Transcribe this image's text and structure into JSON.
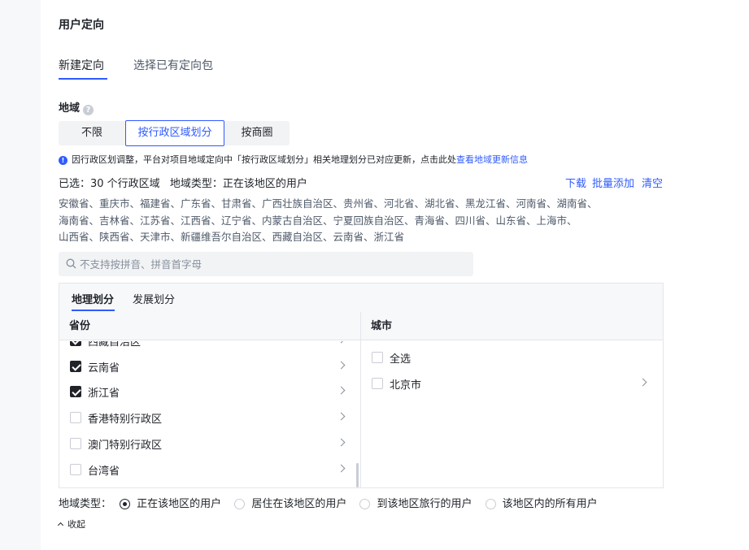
{
  "section_title": "用户定向",
  "top_tabs": [
    {
      "label": "新建定向",
      "active": true
    },
    {
      "label": "选择已有定向包",
      "active": false
    }
  ],
  "region": {
    "label": "地域",
    "help_icon": "question-circle-icon",
    "modes": [
      "不限",
      "按行政区域划分",
      "按商圈"
    ],
    "active_mode": "按行政区域划分"
  },
  "notice": {
    "icon": "info-circle-icon",
    "text": "因行政区划调整，平台对项目地域定向中「按行政区域划分」相关地理划分已对应更新，点击此处",
    "link": "查看地域更新信息"
  },
  "summary": {
    "selected": "已选：30 个行政区域",
    "type": "地域类型：正在该地区的用户"
  },
  "actions": {
    "download": "下载",
    "batch_add": "批量添加",
    "clear": "清空"
  },
  "regions_line1": "安徽省、重庆市、福建省、广东省、甘肃省、广西壮族自治区、贵州省、河北省、湖北省、黑龙江省、河南省、湖南省、",
  "regions_line2": "海南省、吉林省、江苏省、江西省、辽宁省、内蒙古自治区、宁夏回族自治区、青海省、四川省、山东省、上海市、",
  "regions_line3": "山西省、陕西省、天津市、新疆维吾尔自治区、西藏自治区、云南省、浙江省",
  "search": {
    "placeholder": "不支持按拼音、拼音首字母",
    "value": ""
  },
  "tree_tabs": [
    {
      "label": "地理划分",
      "active": true
    },
    {
      "label": "发展划分",
      "active": false
    }
  ],
  "columns": {
    "province": "省份",
    "city": "城市"
  },
  "provinces": [
    {
      "label": "西藏自治区",
      "checked": true
    },
    {
      "label": "云南省",
      "checked": true
    },
    {
      "label": "浙江省",
      "checked": true
    },
    {
      "label": "香港特别行政区",
      "checked": false
    },
    {
      "label": "澳门特别行政区",
      "checked": false
    },
    {
      "label": "台湾省",
      "checked": false
    }
  ],
  "cities": [
    {
      "label": "全选",
      "checked": false
    },
    {
      "label": "北京市",
      "checked": false
    }
  ],
  "region_type": {
    "label": "地域类型：",
    "options": [
      "正在该地区的用户",
      "居住在该地区的用户",
      "到该地区旅行的用户",
      "该地区内的所有用户"
    ],
    "selected": "正在该地区的用户"
  },
  "collapse_label": "收起",
  "colors": {
    "accent": "#2f5bff",
    "text": "#1f2329",
    "muted": "#4e5969"
  }
}
